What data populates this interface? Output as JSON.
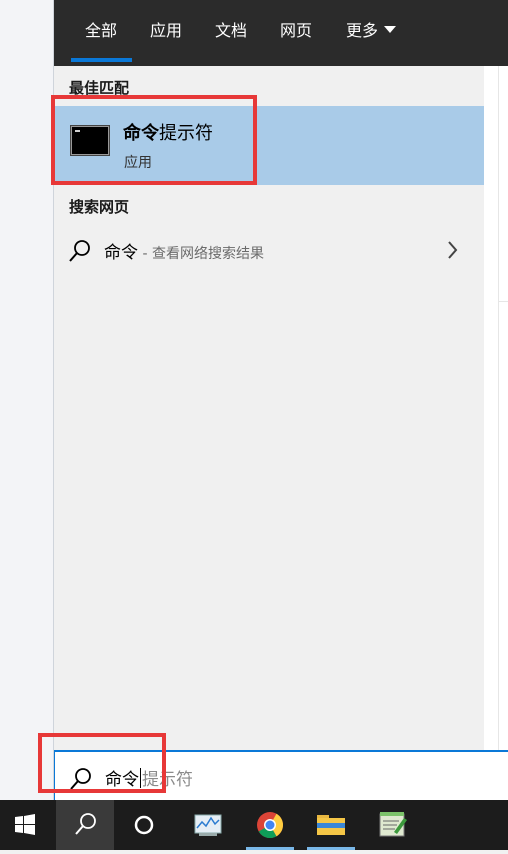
{
  "tabs": {
    "all": "全部",
    "apps": "应用",
    "documents": "文档",
    "web": "网页",
    "more": "更多"
  },
  "best_match": {
    "section_title": "最佳匹配",
    "name_bold": "命令",
    "name_rest": "提示符",
    "type": "应用"
  },
  "web_search": {
    "section_title": "搜索网页",
    "query": "命令",
    "description": " - 查看网络搜索结果"
  },
  "search_box": {
    "typed": "命令",
    "suggestion": "提示符"
  },
  "colors": {
    "topbar": "#2b2b2b",
    "accent": "#0a78d7",
    "selected_item": "#a9cbe8",
    "highlight_box": "#e73838",
    "taskbar": "#1c1c1c"
  },
  "taskbar": {
    "icons": [
      "windows-start-icon",
      "search-icon",
      "cortana-icon",
      "task-manager-icon",
      "chrome-icon",
      "file-explorer-icon",
      "notepad-app-icon"
    ]
  }
}
